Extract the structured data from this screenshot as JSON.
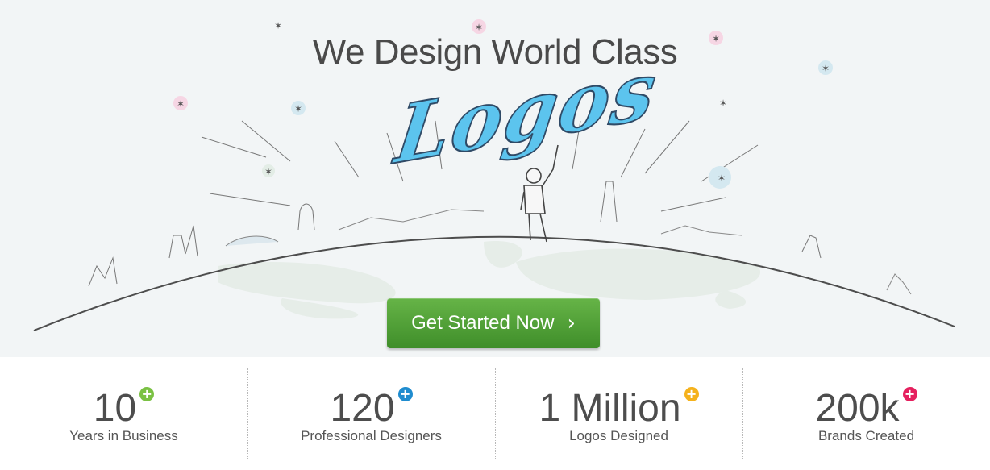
{
  "hero": {
    "headline": "We Design World Class",
    "highlight_word": "Logos",
    "cta_label": "Get Started Now",
    "cta_icon": "chevron-right-icon"
  },
  "stats": [
    {
      "value": "10",
      "label": "Years in Business",
      "badge_color": "#7ac143",
      "badge_icon": "plus-icon"
    },
    {
      "value": "120",
      "label": "Professional Designers",
      "badge_color": "#1f8ccf",
      "badge_icon": "plus-icon"
    },
    {
      "value": "1 Million",
      "label": "Logos Designed",
      "badge_color": "#f5b21c",
      "badge_icon": "plus-icon"
    },
    {
      "value": "200k",
      "label": "Brands Created",
      "badge_color": "#e5205e",
      "badge_icon": "plus-icon"
    }
  ],
  "colors": {
    "hero_background": "#f2f5f6",
    "cta_green": "#4e9f34",
    "logo_blue": "#5cc4ee",
    "text_dark": "#4a4a4a"
  }
}
